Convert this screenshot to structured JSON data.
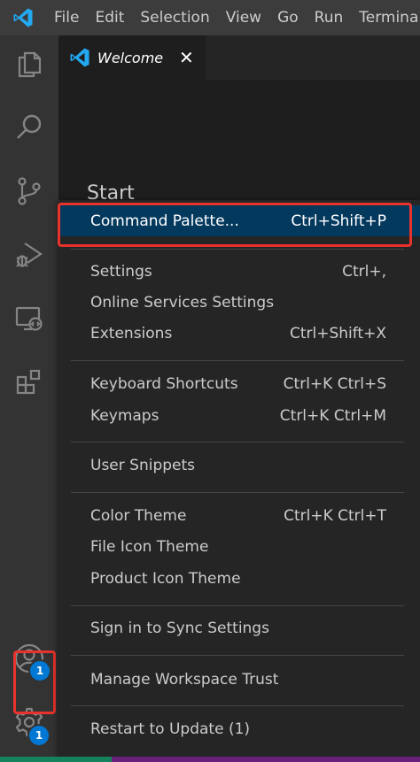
{
  "menubar": {
    "items": [
      "File",
      "Edit",
      "Selection",
      "View",
      "Go",
      "Run",
      "Terminal"
    ]
  },
  "colors": {
    "accent": "#0078d4",
    "highlight_red": "#e8322c",
    "menu_selected": "#04395e",
    "vscode_blue": "#23a9f2"
  },
  "activitybar": {
    "items": [
      {
        "icon": "explorer-icon"
      },
      {
        "icon": "search-icon"
      },
      {
        "icon": "source-control-icon"
      },
      {
        "icon": "run-debug-icon"
      },
      {
        "icon": "remote-explorer-icon"
      },
      {
        "icon": "extensions-icon"
      }
    ],
    "accounts_badge": "1",
    "manage_badge": "1"
  },
  "tab": {
    "label": "Welcome",
    "close": "✕"
  },
  "editor": {
    "heading": "Start"
  },
  "context_menu": {
    "items": [
      {
        "label": "Command Palette...",
        "shortcut": "Ctrl+Shift+P",
        "selected": true
      },
      {
        "label": "Settings",
        "shortcut": "Ctrl+,"
      },
      {
        "label": "Online Services Settings",
        "shortcut": ""
      },
      {
        "label": "Extensions",
        "shortcut": "Ctrl+Shift+X"
      },
      {
        "label": "Keyboard Shortcuts",
        "shortcut": "Ctrl+K Ctrl+S"
      },
      {
        "label": "Keymaps",
        "shortcut": "Ctrl+K Ctrl+M"
      },
      {
        "label": "User Snippets",
        "shortcut": ""
      },
      {
        "label": "Color Theme",
        "shortcut": "Ctrl+K Ctrl+T"
      },
      {
        "label": "File Icon Theme",
        "shortcut": ""
      },
      {
        "label": "Product Icon Theme",
        "shortcut": ""
      },
      {
        "label": "Sign in to Sync Settings",
        "shortcut": ""
      },
      {
        "label": "Manage Workspace Trust",
        "shortcut": ""
      },
      {
        "label": "Restart to Update (1)",
        "shortcut": ""
      }
    ]
  }
}
